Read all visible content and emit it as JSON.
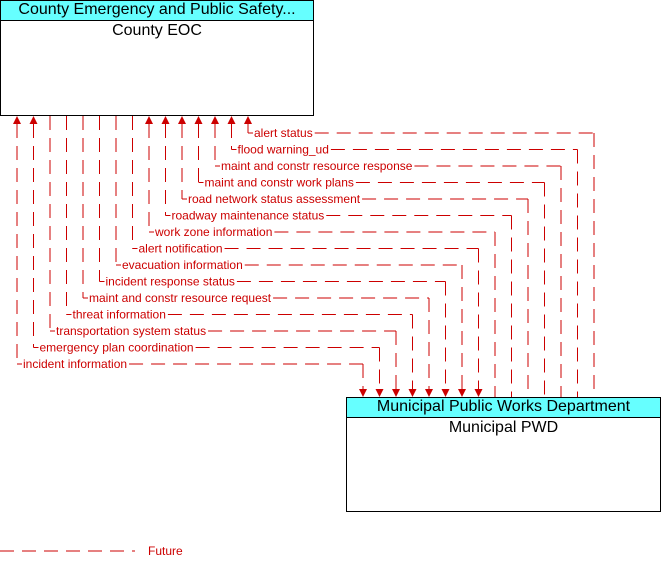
{
  "nodes": {
    "county": {
      "header": "County Emergency and Public Safety...",
      "name": "County EOC"
    },
    "municipal": {
      "header": "Municipal Public Works Department",
      "name": "Municipal PWD"
    }
  },
  "flows": [
    {
      "label": "alert status",
      "direction": "to-county"
    },
    {
      "label": "flood warning_ud",
      "direction": "to-county"
    },
    {
      "label": "maint and constr resource response",
      "direction": "to-county"
    },
    {
      "label": "maint and constr work plans",
      "direction": "to-county"
    },
    {
      "label": "road network status assessment",
      "direction": "to-county"
    },
    {
      "label": "roadway maintenance status",
      "direction": "to-county"
    },
    {
      "label": "work zone information",
      "direction": "to-county"
    },
    {
      "label": "alert notification",
      "direction": "to-municipal"
    },
    {
      "label": "evacuation information",
      "direction": "to-municipal"
    },
    {
      "label": "incident response status",
      "direction": "to-municipal"
    },
    {
      "label": "maint and constr resource request",
      "direction": "to-municipal"
    },
    {
      "label": "threat information",
      "direction": "to-municipal"
    },
    {
      "label": "transportation system status",
      "direction": "to-municipal"
    },
    {
      "label": "emergency plan coordination",
      "direction": "both"
    },
    {
      "label": "incident information",
      "direction": "both"
    }
  ],
  "legend": {
    "label": "Future",
    "style": "dashed"
  },
  "colors": {
    "flow": "#cc0000",
    "header": "#66ffff"
  }
}
